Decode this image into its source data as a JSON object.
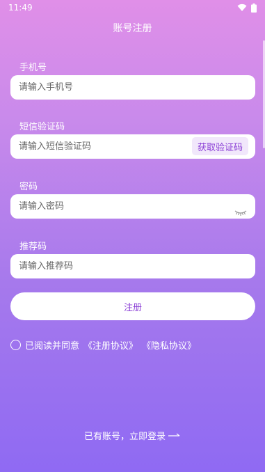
{
  "status_bar": {
    "time": "11:49"
  },
  "header": {
    "title": "账号注册"
  },
  "form": {
    "phone": {
      "label": "手机号",
      "placeholder": "请输入手机号"
    },
    "sms": {
      "label": "短信验证码",
      "placeholder": "请输入短信验证码",
      "button": "获取验证码"
    },
    "password": {
      "label": "密码",
      "placeholder": "请输入密码"
    },
    "referral": {
      "label": "推荐码",
      "placeholder": "请输入推荐码"
    },
    "submit": "注册"
  },
  "agreement": {
    "prefix": "已阅读并同意",
    "terms": "《注册协议》",
    "privacy": "《隐私协议》"
  },
  "footer": {
    "login_text": "已有账号，立即登录"
  },
  "colors": {
    "accent": "#8b3fd6",
    "gradient_top": "#e08fe8",
    "gradient_bottom": "#8f6af3"
  },
  "icons": {
    "wifi": "wifi-icon",
    "battery": "battery-icon",
    "eye": "eye-closed-icon",
    "arrow": "arrow-right-icon"
  }
}
